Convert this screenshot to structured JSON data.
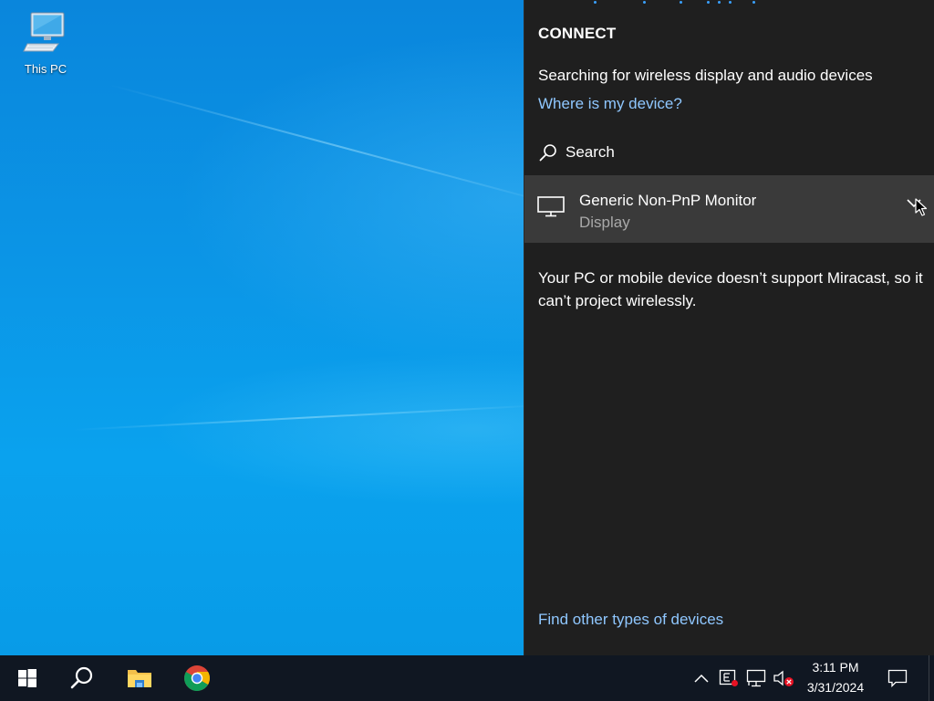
{
  "desktop": {
    "icons": [
      {
        "label": "This PC",
        "icon": "computer-icon"
      }
    ]
  },
  "connect_panel": {
    "title": "CONNECT",
    "status_text": "Searching for wireless display and audio devices",
    "where_link": "Where is my device?",
    "search_label": "Search",
    "device": {
      "name": "Generic Non-PnP Monitor",
      "type": "Display",
      "icon": "monitor-icon"
    },
    "message": "Your PC or mobile device doesn’t support Miracast, so it can’t project wirelessly.",
    "find_link": "Find other types of devices"
  },
  "taskbar": {
    "apps": [
      {
        "name": "Start",
        "icon": "windows-start-icon"
      },
      {
        "name": "Search",
        "icon": "search-icon"
      },
      {
        "name": "File Explorer",
        "icon": "folder-icon"
      },
      {
        "name": "Google Chrome",
        "icon": "chrome-icon"
      }
    ],
    "tray": [
      "chevron-up-icon",
      "ime-icon",
      "network-icon",
      "volume-muted-icon"
    ],
    "time": "3:11 PM",
    "date": "3/31/2024"
  },
  "colors": {
    "panel_bg": "#1f1f1f",
    "device_row_bg": "#3a3a3a",
    "link": "#8fc7ff",
    "taskbar_bg": "#101722",
    "desktop_blue": "#0a86dc"
  }
}
